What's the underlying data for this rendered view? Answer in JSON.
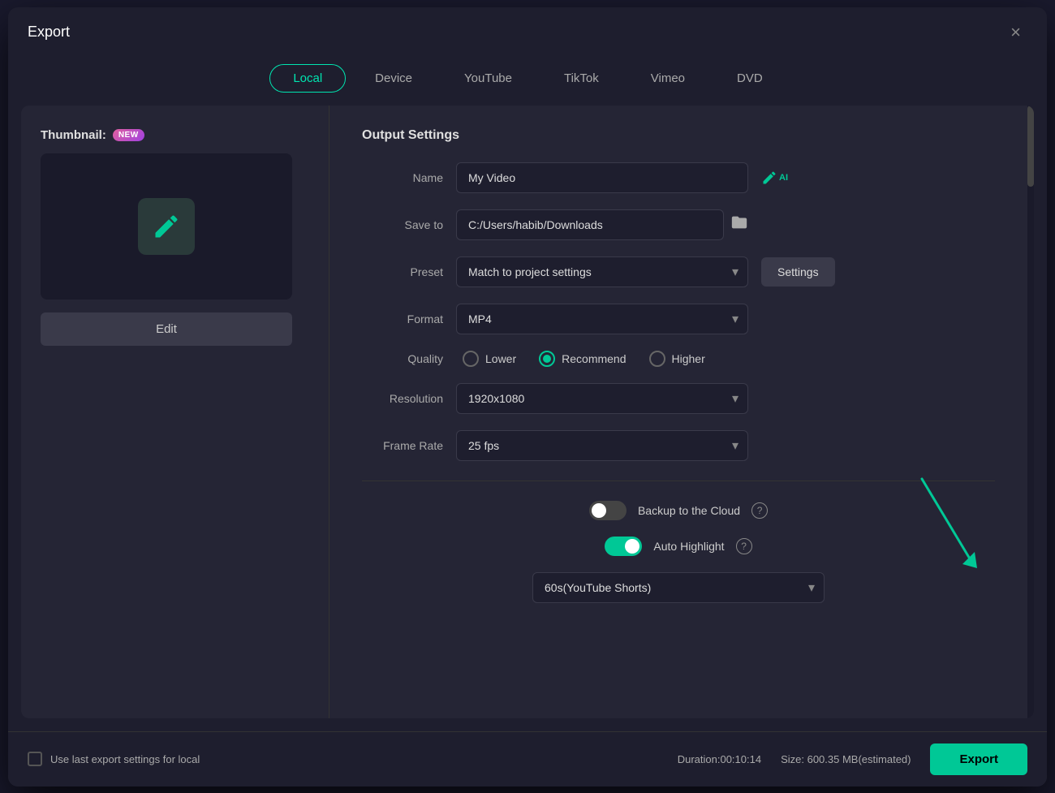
{
  "dialog": {
    "title": "Export",
    "close_label": "×"
  },
  "tabs": [
    {
      "id": "local",
      "label": "Local",
      "active": true
    },
    {
      "id": "device",
      "label": "Device",
      "active": false
    },
    {
      "id": "youtube",
      "label": "YouTube",
      "active": false
    },
    {
      "id": "tiktok",
      "label": "TikTok",
      "active": false
    },
    {
      "id": "vimeo",
      "label": "Vimeo",
      "active": false
    },
    {
      "id": "dvd",
      "label": "DVD",
      "active": false
    }
  ],
  "left_panel": {
    "thumbnail_label": "Thumbnail:",
    "new_badge": "NEW",
    "edit_button": "Edit"
  },
  "output_settings": {
    "title": "Output Settings",
    "name_label": "Name",
    "name_value": "My Video",
    "save_to_label": "Save to",
    "save_to_value": "C:/Users/habib/Downloads",
    "preset_label": "Preset",
    "preset_value": "Match to project settings",
    "settings_button": "Settings",
    "format_label": "Format",
    "format_value": "MP4",
    "quality_label": "Quality",
    "quality_options": [
      {
        "id": "lower",
        "label": "Lower",
        "checked": false
      },
      {
        "id": "recommend",
        "label": "Recommend",
        "checked": true
      },
      {
        "id": "higher",
        "label": "Higher",
        "checked": false
      }
    ],
    "resolution_label": "Resolution",
    "resolution_value": "1920x1080",
    "frame_rate_label": "Frame Rate",
    "frame_rate_value": "25 fps",
    "backup_cloud_label": "Backup to the Cloud",
    "backup_cloud_on": false,
    "auto_highlight_label": "Auto Highlight",
    "auto_highlight_on": true,
    "highlight_duration_value": "60s(YouTube Shorts)"
  },
  "bottom_bar": {
    "last_export_label": "Use last export settings for local",
    "duration_label": "Duration:00:10:14",
    "size_label": "Size: 600.35 MB(estimated)",
    "export_button": "Export"
  }
}
